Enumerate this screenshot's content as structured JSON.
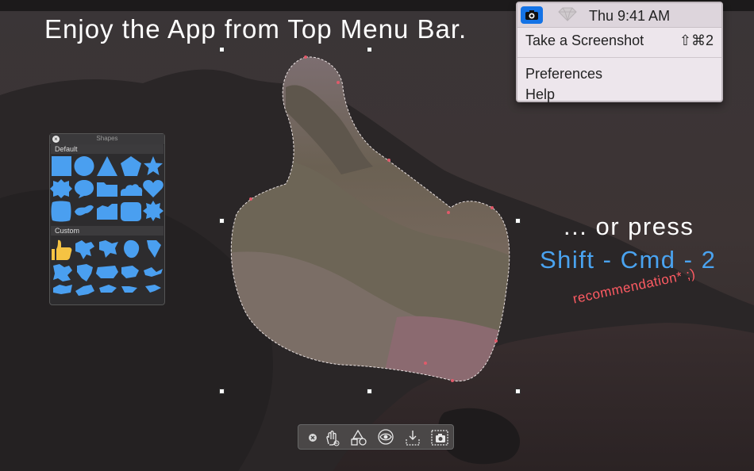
{
  "headline": "Enjoy the App from Top Menu Bar.",
  "promo": {
    "press_text": "... or press",
    "shortcut_text": "Shift - Cmd - 2",
    "recommendation": "recommendation* ;)"
  },
  "menu": {
    "clock": "Thu 9:41 AM",
    "items": {
      "take_screenshot": "Take a Screenshot",
      "take_screenshot_shortcut": "⇧⌘2",
      "preferences": "Preferences",
      "help": "Help"
    }
  },
  "shapes_panel": {
    "title": "Shapes",
    "default_label": "Default",
    "custom_label": "Custom"
  },
  "colors": {
    "shape_blue": "#4a9ff0",
    "thumb_yellow": "#f5c343",
    "accent": "#4aa3f0",
    "recommend": "#ff5b63"
  },
  "toolbar": {
    "icons": [
      "close-icon",
      "hand-gesture-icon",
      "shapes-icon",
      "eye-icon",
      "save-download-icon",
      "camera-capture-icon"
    ]
  }
}
